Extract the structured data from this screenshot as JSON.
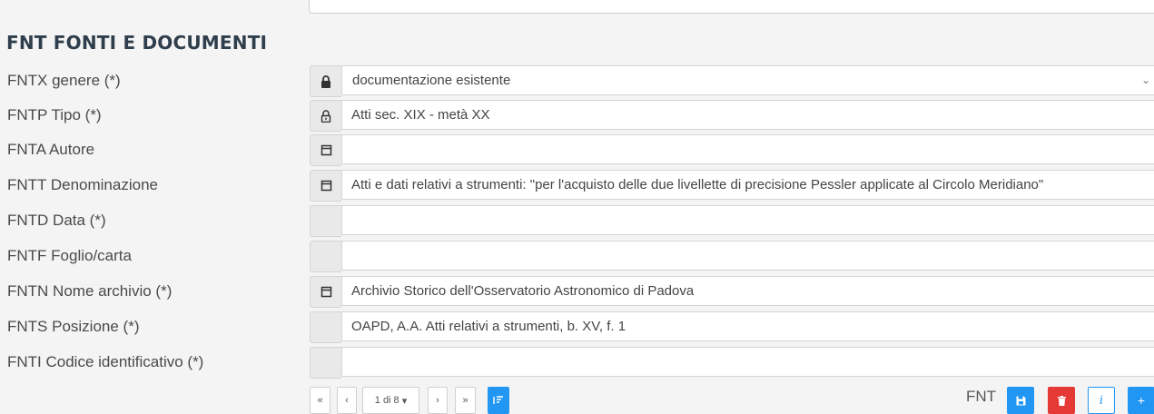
{
  "section": {
    "title": "FNT FONTI E DOCUMENTI"
  },
  "fields": [
    {
      "label": "FNTX genere (*)",
      "value": "documentazione esistente",
      "icon": "lock-icon",
      "type": "select"
    },
    {
      "label": "FNTP Tipo (*)",
      "value": "Atti sec. XIX - metà XX",
      "icon": "unlock-icon",
      "type": "text"
    },
    {
      "label": "FNTA Autore",
      "value": "",
      "icon": "document-icon",
      "type": "text"
    },
    {
      "label": "FNTT Denominazione",
      "value": "Atti e dati relativi a strumenti: \"per l'acquisto delle due livellette di precisione Pessler applicate al Circolo Meridiano\"",
      "icon": "document-icon",
      "type": "text"
    },
    {
      "label": "FNTD Data (*)",
      "value": "",
      "icon": "",
      "type": "text"
    },
    {
      "label": "FNTF Foglio/carta",
      "value": "",
      "icon": "",
      "type": "text"
    },
    {
      "label": "FNTN Nome archivio (*)",
      "value": "Archivio Storico dell'Osservatorio Astronomico di Padova",
      "icon": "document-icon",
      "type": "text"
    },
    {
      "label": "FNTS Posizione (*)",
      "value": "OAPD, A.A. Atti relativi a strumenti, b. XV, f. 1",
      "icon": "",
      "type": "text"
    },
    {
      "label": "FNTI Codice identificativo (*)",
      "value": "",
      "icon": "",
      "type": "text"
    }
  ],
  "pagination": {
    "first": "«",
    "prev": "‹",
    "page": "1 di 8",
    "next": "›",
    "last": "»"
  },
  "actions": {
    "group_label": "FNT",
    "info": "i",
    "add": "+"
  },
  "colors": {
    "primary": "#2196f3",
    "danger": "#e53935",
    "title": "#2f3e4c"
  }
}
